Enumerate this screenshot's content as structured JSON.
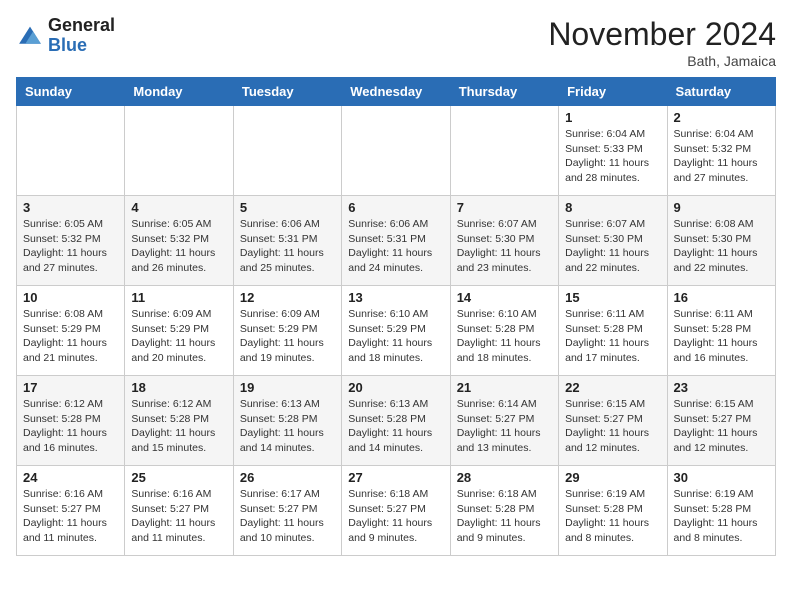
{
  "header": {
    "logo_general": "General",
    "logo_blue": "Blue",
    "month": "November 2024",
    "location": "Bath, Jamaica"
  },
  "weekdays": [
    "Sunday",
    "Monday",
    "Tuesday",
    "Wednesday",
    "Thursday",
    "Friday",
    "Saturday"
  ],
  "weeks": [
    [
      {
        "day": "",
        "info": ""
      },
      {
        "day": "",
        "info": ""
      },
      {
        "day": "",
        "info": ""
      },
      {
        "day": "",
        "info": ""
      },
      {
        "day": "",
        "info": ""
      },
      {
        "day": "1",
        "info": "Sunrise: 6:04 AM\nSunset: 5:33 PM\nDaylight: 11 hours and 28 minutes."
      },
      {
        "day": "2",
        "info": "Sunrise: 6:04 AM\nSunset: 5:32 PM\nDaylight: 11 hours and 27 minutes."
      }
    ],
    [
      {
        "day": "3",
        "info": "Sunrise: 6:05 AM\nSunset: 5:32 PM\nDaylight: 11 hours and 27 minutes."
      },
      {
        "day": "4",
        "info": "Sunrise: 6:05 AM\nSunset: 5:32 PM\nDaylight: 11 hours and 26 minutes."
      },
      {
        "day": "5",
        "info": "Sunrise: 6:06 AM\nSunset: 5:31 PM\nDaylight: 11 hours and 25 minutes."
      },
      {
        "day": "6",
        "info": "Sunrise: 6:06 AM\nSunset: 5:31 PM\nDaylight: 11 hours and 24 minutes."
      },
      {
        "day": "7",
        "info": "Sunrise: 6:07 AM\nSunset: 5:30 PM\nDaylight: 11 hours and 23 minutes."
      },
      {
        "day": "8",
        "info": "Sunrise: 6:07 AM\nSunset: 5:30 PM\nDaylight: 11 hours and 22 minutes."
      },
      {
        "day": "9",
        "info": "Sunrise: 6:08 AM\nSunset: 5:30 PM\nDaylight: 11 hours and 22 minutes."
      }
    ],
    [
      {
        "day": "10",
        "info": "Sunrise: 6:08 AM\nSunset: 5:29 PM\nDaylight: 11 hours and 21 minutes."
      },
      {
        "day": "11",
        "info": "Sunrise: 6:09 AM\nSunset: 5:29 PM\nDaylight: 11 hours and 20 minutes."
      },
      {
        "day": "12",
        "info": "Sunrise: 6:09 AM\nSunset: 5:29 PM\nDaylight: 11 hours and 19 minutes."
      },
      {
        "day": "13",
        "info": "Sunrise: 6:10 AM\nSunset: 5:29 PM\nDaylight: 11 hours and 18 minutes."
      },
      {
        "day": "14",
        "info": "Sunrise: 6:10 AM\nSunset: 5:28 PM\nDaylight: 11 hours and 18 minutes."
      },
      {
        "day": "15",
        "info": "Sunrise: 6:11 AM\nSunset: 5:28 PM\nDaylight: 11 hours and 17 minutes."
      },
      {
        "day": "16",
        "info": "Sunrise: 6:11 AM\nSunset: 5:28 PM\nDaylight: 11 hours and 16 minutes."
      }
    ],
    [
      {
        "day": "17",
        "info": "Sunrise: 6:12 AM\nSunset: 5:28 PM\nDaylight: 11 hours and 16 minutes."
      },
      {
        "day": "18",
        "info": "Sunrise: 6:12 AM\nSunset: 5:28 PM\nDaylight: 11 hours and 15 minutes."
      },
      {
        "day": "19",
        "info": "Sunrise: 6:13 AM\nSunset: 5:28 PM\nDaylight: 11 hours and 14 minutes."
      },
      {
        "day": "20",
        "info": "Sunrise: 6:13 AM\nSunset: 5:28 PM\nDaylight: 11 hours and 14 minutes."
      },
      {
        "day": "21",
        "info": "Sunrise: 6:14 AM\nSunset: 5:27 PM\nDaylight: 11 hours and 13 minutes."
      },
      {
        "day": "22",
        "info": "Sunrise: 6:15 AM\nSunset: 5:27 PM\nDaylight: 11 hours and 12 minutes."
      },
      {
        "day": "23",
        "info": "Sunrise: 6:15 AM\nSunset: 5:27 PM\nDaylight: 11 hours and 12 minutes."
      }
    ],
    [
      {
        "day": "24",
        "info": "Sunrise: 6:16 AM\nSunset: 5:27 PM\nDaylight: 11 hours and 11 minutes."
      },
      {
        "day": "25",
        "info": "Sunrise: 6:16 AM\nSunset: 5:27 PM\nDaylight: 11 hours and 11 minutes."
      },
      {
        "day": "26",
        "info": "Sunrise: 6:17 AM\nSunset: 5:27 PM\nDaylight: 11 hours and 10 minutes."
      },
      {
        "day": "27",
        "info": "Sunrise: 6:18 AM\nSunset: 5:27 PM\nDaylight: 11 hours and 9 minutes."
      },
      {
        "day": "28",
        "info": "Sunrise: 6:18 AM\nSunset: 5:28 PM\nDaylight: 11 hours and 9 minutes."
      },
      {
        "day": "29",
        "info": "Sunrise: 6:19 AM\nSunset: 5:28 PM\nDaylight: 11 hours and 8 minutes."
      },
      {
        "day": "30",
        "info": "Sunrise: 6:19 AM\nSunset: 5:28 PM\nDaylight: 11 hours and 8 minutes."
      }
    ]
  ]
}
